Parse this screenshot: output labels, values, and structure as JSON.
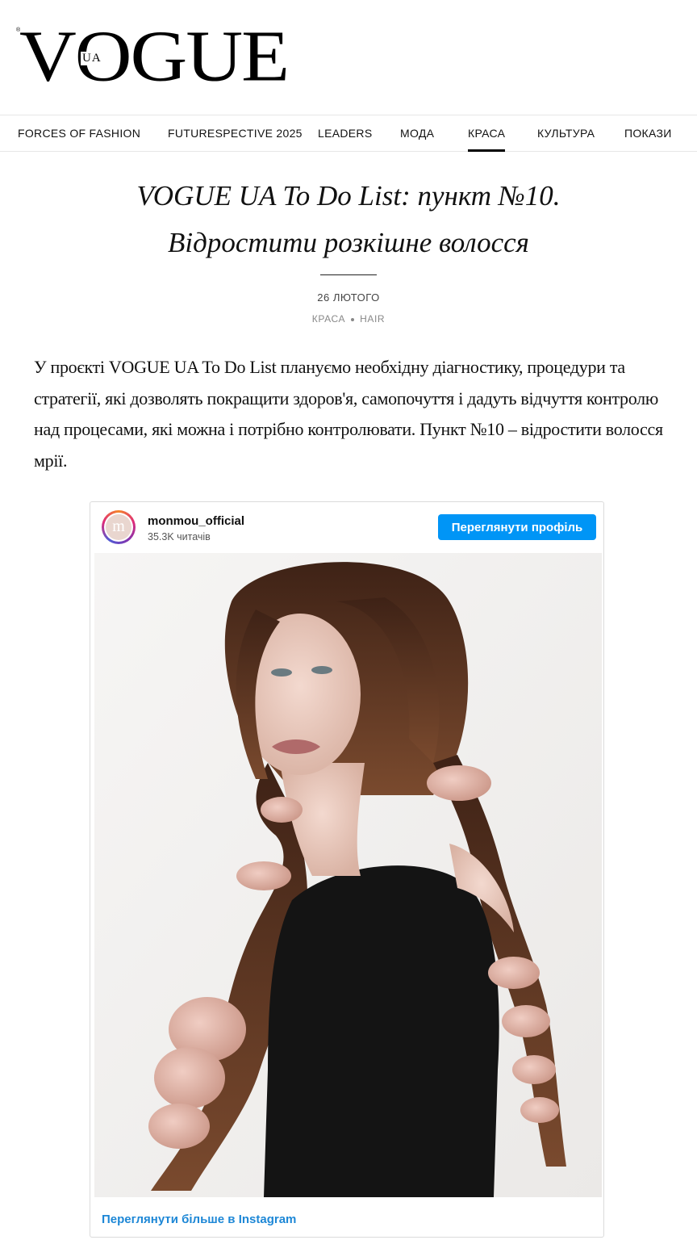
{
  "brand": {
    "logo_text": "VOGUE",
    "logo_edition": "UA",
    "logo_reg": "®"
  },
  "nav": {
    "items": [
      {
        "label": "FORCES OF FASHION",
        "active": false
      },
      {
        "label": "FUTURESPECTIVE 2025",
        "active": false
      },
      {
        "label": "LEADERS",
        "active": false
      },
      {
        "label": "МОДА",
        "active": false
      },
      {
        "label": "КРАСА",
        "active": true
      },
      {
        "label": "КУЛЬТУРА",
        "active": false
      },
      {
        "label": "ПОКАЗИ",
        "active": false
      }
    ]
  },
  "article": {
    "title_line1": "VOGUE UA To Do List: пункт №10.",
    "title_line2": "Відростити розкішне волосся",
    "date": "26 ЛЮТОГО",
    "tags": [
      "КРАСА",
      "HAIR"
    ],
    "lead": "У проєкті VOGUE UA To Do List плануємо необхідну діагностику, процедури та стратегії, які дозволять покращити здоров'я, самопочуття і дадуть відчуття контролю над процесами, які можна і потрібно контролювати. Пункт №10 – відростити волосся мрії."
  },
  "instagram_embed": {
    "avatar_letter": "m",
    "username": "monmou_official",
    "followers": "35.3K читачів",
    "view_profile_label": "Переглянути профіль",
    "view_more_label": "Переглянути більше в Instagram"
  },
  "colors": {
    "accent_button": "#0095f6",
    "link": "#1d87d6",
    "scrunchie": "#d9aca0",
    "hair": "#5a3422",
    "dress": "#141414"
  }
}
